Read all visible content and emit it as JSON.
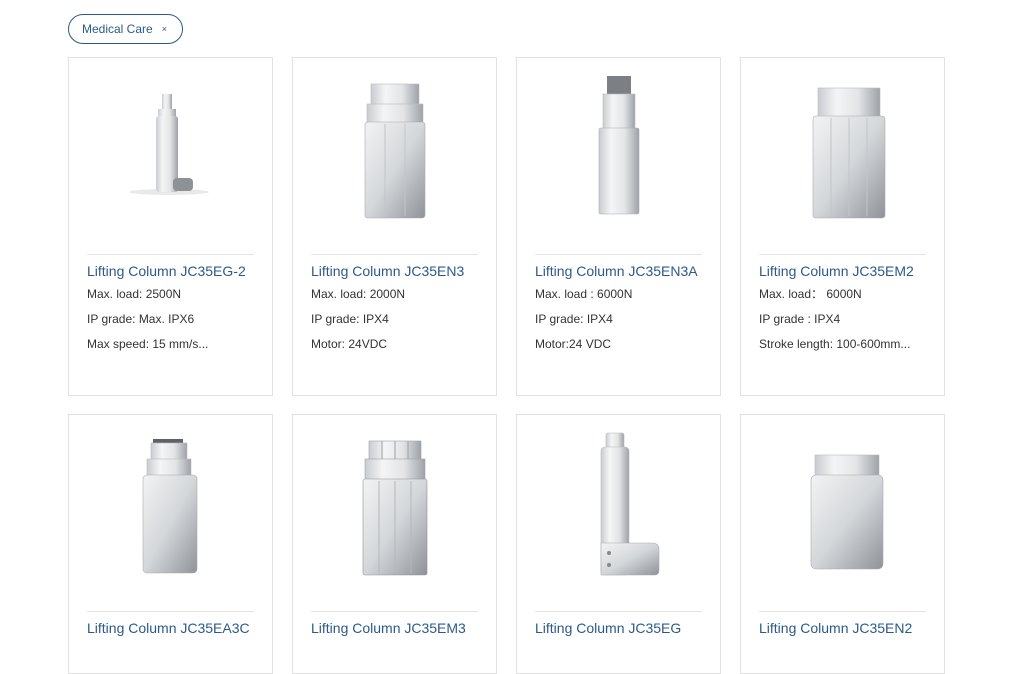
{
  "filter": {
    "label": "Medical Care",
    "remove_icon": "×"
  },
  "products": [
    {
      "title": "Lifting Column JC35EG-2",
      "specs": [
        "Max. load: 2500N",
        "IP grade: Max. IPX6",
        "Max speed: 15 mm/s..."
      ]
    },
    {
      "title": "Lifting Column JC35EN3",
      "specs": [
        "Max. load: 2000N",
        "IP grade: IPX4",
        "Motor: 24VDC"
      ]
    },
    {
      "title": "Lifting Column JC35EN3A",
      "specs": [
        "Max. load : 6000N",
        "IP grade: IPX4",
        "Motor:24 VDC"
      ]
    },
    {
      "title": "Lifting Column JC35EM2",
      "specs": [
        "Max. load： 6000N",
        "IP grade : IPX4",
        "Stroke length: 100-600mm..."
      ]
    },
    {
      "title": "Lifting Column JC35EA3C",
      "specs": []
    },
    {
      "title": "Lifting Column JC35EM3",
      "specs": []
    },
    {
      "title": "Lifting Column JC35EG",
      "specs": []
    },
    {
      "title": "Lifting Column JC35EN2",
      "specs": []
    }
  ]
}
